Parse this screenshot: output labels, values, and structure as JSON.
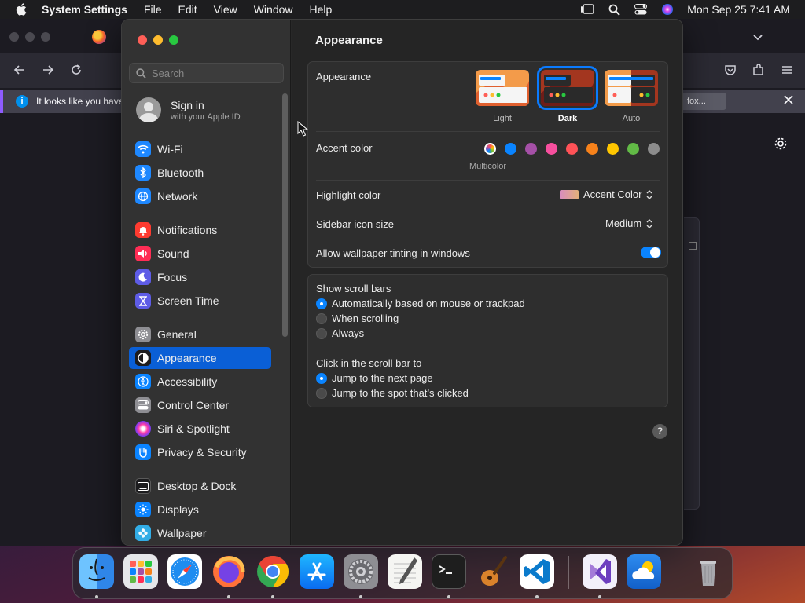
{
  "menubar": {
    "app_name": "System Settings",
    "menus": [
      "File",
      "Edit",
      "View",
      "Window",
      "Help"
    ],
    "clock": "Mon Sep 25  7:41 AM"
  },
  "browser": {
    "info_text": "It looks like you have",
    "info_button": "fox..."
  },
  "sidebar": {
    "search_placeholder": "Search",
    "signin_title": "Sign in",
    "signin_subtitle": "with your Apple ID",
    "items": [
      {
        "label": "Wi-Fi",
        "color": "#1e88ff"
      },
      {
        "label": "Bluetooth",
        "color": "#1e88ff"
      },
      {
        "label": "Network",
        "color": "#1e88ff"
      },
      {
        "label": "Notifications",
        "color": "#ff3b30"
      },
      {
        "label": "Sound",
        "color": "#ff2d55"
      },
      {
        "label": "Focus",
        "color": "#5e5ce6"
      },
      {
        "label": "Screen Time",
        "color": "#5e5ce6"
      },
      {
        "label": "General",
        "color": "#8e8e93"
      },
      {
        "label": "Appearance",
        "color": "#1c1c1e"
      },
      {
        "label": "Accessibility",
        "color": "#0a84ff"
      },
      {
        "label": "Control Center",
        "color": "#8e8e93"
      },
      {
        "label": "Siri & Spotlight",
        "color": "#7a3cff"
      },
      {
        "label": "Privacy & Security",
        "color": "#0a84ff"
      },
      {
        "label": "Desktop & Dock",
        "color": "#1c1c1e"
      },
      {
        "label": "Displays",
        "color": "#0a84ff"
      },
      {
        "label": "Wallpaper",
        "color": "#32ade6"
      }
    ],
    "selected": "Appearance"
  },
  "pane": {
    "title": "Appearance",
    "appearance": {
      "label": "Appearance",
      "options": [
        "Light",
        "Dark",
        "Auto"
      ],
      "selected": "Dark"
    },
    "accent": {
      "label": "Accent color",
      "caption": "Multicolor",
      "colors": [
        "#ffffff",
        "#0a84ff",
        "#a550a7",
        "#f74f9e",
        "#ff5257",
        "#f7821b",
        "#ffc600",
        "#62ba46",
        "#8c8c8c"
      ]
    },
    "highlight": {
      "label": "Highlight color",
      "value": "Accent Color"
    },
    "sidebar_icon_size": {
      "label": "Sidebar icon size",
      "value": "Medium"
    },
    "wallpaper_tinting": {
      "label": "Allow wallpaper tinting in windows",
      "on": true
    },
    "scroll_bars": {
      "label": "Show scroll bars",
      "options": [
        "Automatically based on mouse or trackpad",
        "When scrolling",
        "Always"
      ],
      "selected": "Automatically based on mouse or trackpad"
    },
    "click_scroll": {
      "label": "Click in the scroll bar to",
      "options": [
        "Jump to the next page",
        "Jump to the spot that’s clicked"
      ],
      "selected": "Jump to the next page"
    },
    "help": "?"
  },
  "dock": {
    "apps": [
      "Finder",
      "Launchpad",
      "Safari",
      "Firefox",
      "Chrome",
      "App Store",
      "System Settings",
      "TextEdit",
      "Terminal",
      "GarageBand",
      "Visual Studio Code",
      "Visual Studio",
      "Weather",
      "Trash"
    ]
  }
}
